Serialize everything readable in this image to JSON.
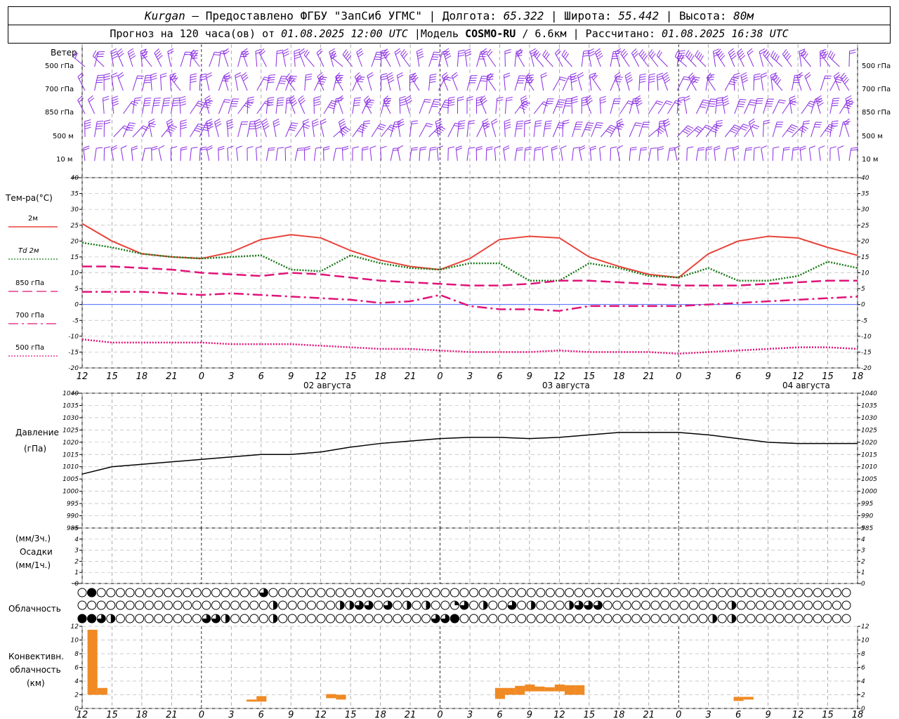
{
  "header": {
    "station": "Kurgan",
    "dash": " — ",
    "provider": "Предоставлено ФГБУ \"ЗапСиб УГМС\"",
    "sep": " | ",
    "lon_label": "Долгота: ",
    "lon_value": "65.322",
    "lat_label": "Широта: ",
    "lat_value": "55.442",
    "alt_label": "Высота: ",
    "alt_value": "80м",
    "forecast_label": "Прогноз на 120 часа(ов) от ",
    "forecast_start": "01.08.2025 12:00 UTC",
    "model_label": " |Модель ",
    "model_name": "COSMO-RU",
    "model_res": " / 6.6км",
    "calc_label": " | Рассчитано: ",
    "calc_time": "01.08.2025 16:38 UTC"
  },
  "labels": {
    "wind_title": "Ветер",
    "lvl_500": "500 гПа",
    "lvl_700": "700 гПа",
    "lvl_850": "850 гПа",
    "lvl_500m": "500 м",
    "lvl_10m": "10  м",
    "temp_title": "Тем-ра(°C)",
    "leg_2m": "2м",
    "leg_td": "Td  2м",
    "leg_850": "850 гПа",
    "leg_700": "700 гПа",
    "leg_500": "500 гПа",
    "pres_title": "Давление",
    "pres_unit": "(гПа)",
    "precip_unit3": "(мм/3ч.)",
    "precip_title": "Осадки",
    "precip_unit1": "(мм/1ч.)",
    "cloud_title": "Облачность",
    "conv_title1": "Конвективн.",
    "conv_title2": "облачность",
    "conv_unit": "(км)",
    "date_02": "02 августа",
    "date_03": "03 августа",
    "date_04": "04 августа"
  },
  "chart_data": {
    "type": "line",
    "hour_ticks": [
      "12",
      "15",
      "18",
      "21",
      "0",
      "3",
      "6",
      "9",
      "12",
      "15",
      "18",
      "21",
      "0",
      "3",
      "6",
      "9",
      "12",
      "15",
      "18",
      "21",
      "0",
      "3",
      "6",
      "9",
      "12",
      "15",
      "18"
    ],
    "hours_from_start": [
      0,
      3,
      6,
      9,
      12,
      15,
      18,
      21,
      24,
      27,
      30,
      33,
      36,
      39,
      42,
      45,
      48,
      51,
      54,
      57,
      60,
      63,
      66,
      69,
      72,
      75,
      78
    ],
    "temperature": {
      "ylim": [
        -20,
        40
      ],
      "ticks": [
        -20,
        -15,
        -10,
        -5,
        0,
        5,
        10,
        15,
        20,
        25,
        30,
        35,
        40
      ],
      "series": [
        {
          "name": "2м",
          "color": "#e8433a",
          "dash": "solid",
          "values": [
            25.5,
            20,
            16,
            15,
            14.5,
            16.5,
            20.5,
            22,
            21,
            17,
            14,
            12,
            11,
            14.5,
            20.5,
            21.5,
            21,
            15,
            12,
            9.5,
            8.5,
            16,
            20,
            21.5,
            21,
            18,
            15.5
          ]
        },
        {
          "name": "Td  2м",
          "color": "#1a7a1a",
          "dash": "dotted",
          "values": [
            19.5,
            18,
            16,
            15,
            14.5,
            15,
            15.5,
            11,
            10.5,
            15.5,
            13,
            11.5,
            11,
            13,
            13,
            7.5,
            7.5,
            13,
            11.5,
            9,
            8.5,
            11.5,
            7.5,
            7.5,
            9,
            13.5,
            11.5
          ]
        },
        {
          "name": "850 гПа",
          "color": "#e0137a",
          "dash": "long",
          "values": [
            12,
            12,
            11.5,
            11,
            10,
            9.5,
            9,
            10,
            9.5,
            8.5,
            7.5,
            7,
            6.5,
            6,
            6,
            6.5,
            7.5,
            7.5,
            7,
            6.5,
            6,
            6,
            6,
            6.5,
            7,
            7.5,
            7.5
          ]
        },
        {
          "name": "700 гПа",
          "color": "#e0137a",
          "dash": "dashdot",
          "values": [
            4,
            4,
            4,
            3.5,
            3,
            3.5,
            3,
            2.5,
            2,
            1.5,
            0.5,
            1,
            3,
            -0.5,
            -1.5,
            -1.5,
            -2,
            -0.5,
            -0.5,
            -0.5,
            -0.5,
            0,
            0.5,
            1,
            1.5,
            2,
            2.5
          ]
        },
        {
          "name": "500 гПа",
          "color": "#e0137a",
          "dash": "dense",
          "values": [
            -11,
            -12,
            -12,
            -12,
            -12,
            -12.5,
            -12.5,
            -12.5,
            -13,
            -13.5,
            -14,
            -14,
            -14.5,
            -15,
            -15,
            -15,
            -14.5,
            -15,
            -15,
            -15,
            -15.5,
            -15,
            -14.5,
            -14,
            -13.5,
            -13.5,
            -14
          ]
        }
      ]
    },
    "pressure": {
      "ylim": [
        985,
        1040
      ],
      "ticks": [
        985,
        990,
        995,
        1000,
        1005,
        1010,
        1015,
        1020,
        1025,
        1030,
        1035,
        1040
      ],
      "series": [
        {
          "name": "",
          "color": "#000000",
          "values": [
            1007,
            1010,
            1011,
            1012,
            1013,
            1014,
            1015,
            1015,
            1016,
            1018,
            1019.5,
            1020.5,
            1021.5,
            1022,
            1022,
            1021.5,
            1022,
            1023,
            1024,
            1024,
            1024,
            1023,
            1021.5,
            1020,
            1019.5,
            1019.5,
            1019.5
          ]
        }
      ]
    },
    "precipitation": {
      "ylim": [
        0,
        5
      ],
      "ticks": [
        0,
        1,
        2,
        3,
        4,
        5
      ],
      "values": []
    },
    "cloudiness": {
      "rows": 3,
      "columns": 81,
      "levels": {
        "0": "clear",
        "1": "quarter",
        "2": "half",
        "3": "three-quarter",
        "4": "overcast"
      },
      "row_top": {
        "1": 4,
        "19": 3
      },
      "row_mid": {
        "20": 2,
        "27": 2,
        "28": 2,
        "29": 3,
        "30": 3,
        "32": 3,
        "34": 2,
        "36": 2,
        "39": 1,
        "40": 3,
        "42": 2,
        "45": 3,
        "47": 2,
        "51": 2,
        "52": 3,
        "53": 3,
        "54": 3,
        "68": 2
      },
      "row_low": {
        "0": 4,
        "1": 4,
        "2": 3,
        "3": 2,
        "13": 3,
        "14": 3,
        "15": 2,
        "20": 2,
        "37": 3,
        "38": 3,
        "39": 4,
        "66": 2,
        "68": 2
      }
    },
    "convective_cloud": {
      "ylim": [
        0,
        12
      ],
      "ticks": [
        0,
        2,
        4,
        6,
        8,
        10,
        12
      ],
      "bars": [
        {
          "hour": 1,
          "base": 2,
          "top": 11.5
        },
        {
          "hour": 2,
          "base": 2,
          "top": 3
        },
        {
          "hour": 17,
          "base": 1,
          "top": 1.3
        },
        {
          "hour": 18,
          "base": 1,
          "top": 1.8
        },
        {
          "hour": 25,
          "base": 1.5,
          "top": 2.1
        },
        {
          "hour": 26,
          "base": 1.3,
          "top": 2
        },
        {
          "hour": 42,
          "base": 1.4,
          "top": 3
        },
        {
          "hour": 43,
          "base": 2,
          "top": 3
        },
        {
          "hour": 44,
          "base": 2,
          "top": 3.3
        },
        {
          "hour": 45,
          "base": 2.5,
          "top": 3.5
        },
        {
          "hour": 46,
          "base": 2.5,
          "top": 3.2
        },
        {
          "hour": 47,
          "base": 2.5,
          "top": 3.1
        },
        {
          "hour": 48,
          "base": 2.5,
          "top": 3.5
        },
        {
          "hour": 49,
          "base": 2,
          "top": 3.4
        },
        {
          "hour": 50,
          "base": 2,
          "top": 3.4
        },
        {
          "hour": 66,
          "base": 1.1,
          "top": 1.7
        },
        {
          "hour": 67,
          "base": 1.3,
          "top": 1.7
        }
      ],
      "color": "#f08a24"
    },
    "wind_levels": [
      "500 гПа",
      "700 гПа",
      "850 гПа",
      "500 м",
      "10  м"
    ],
    "wind_color": "#8a2be2",
    "grid": true,
    "date_labels": [
      "02 августа",
      "03 августа",
      "04 августа"
    ]
  }
}
